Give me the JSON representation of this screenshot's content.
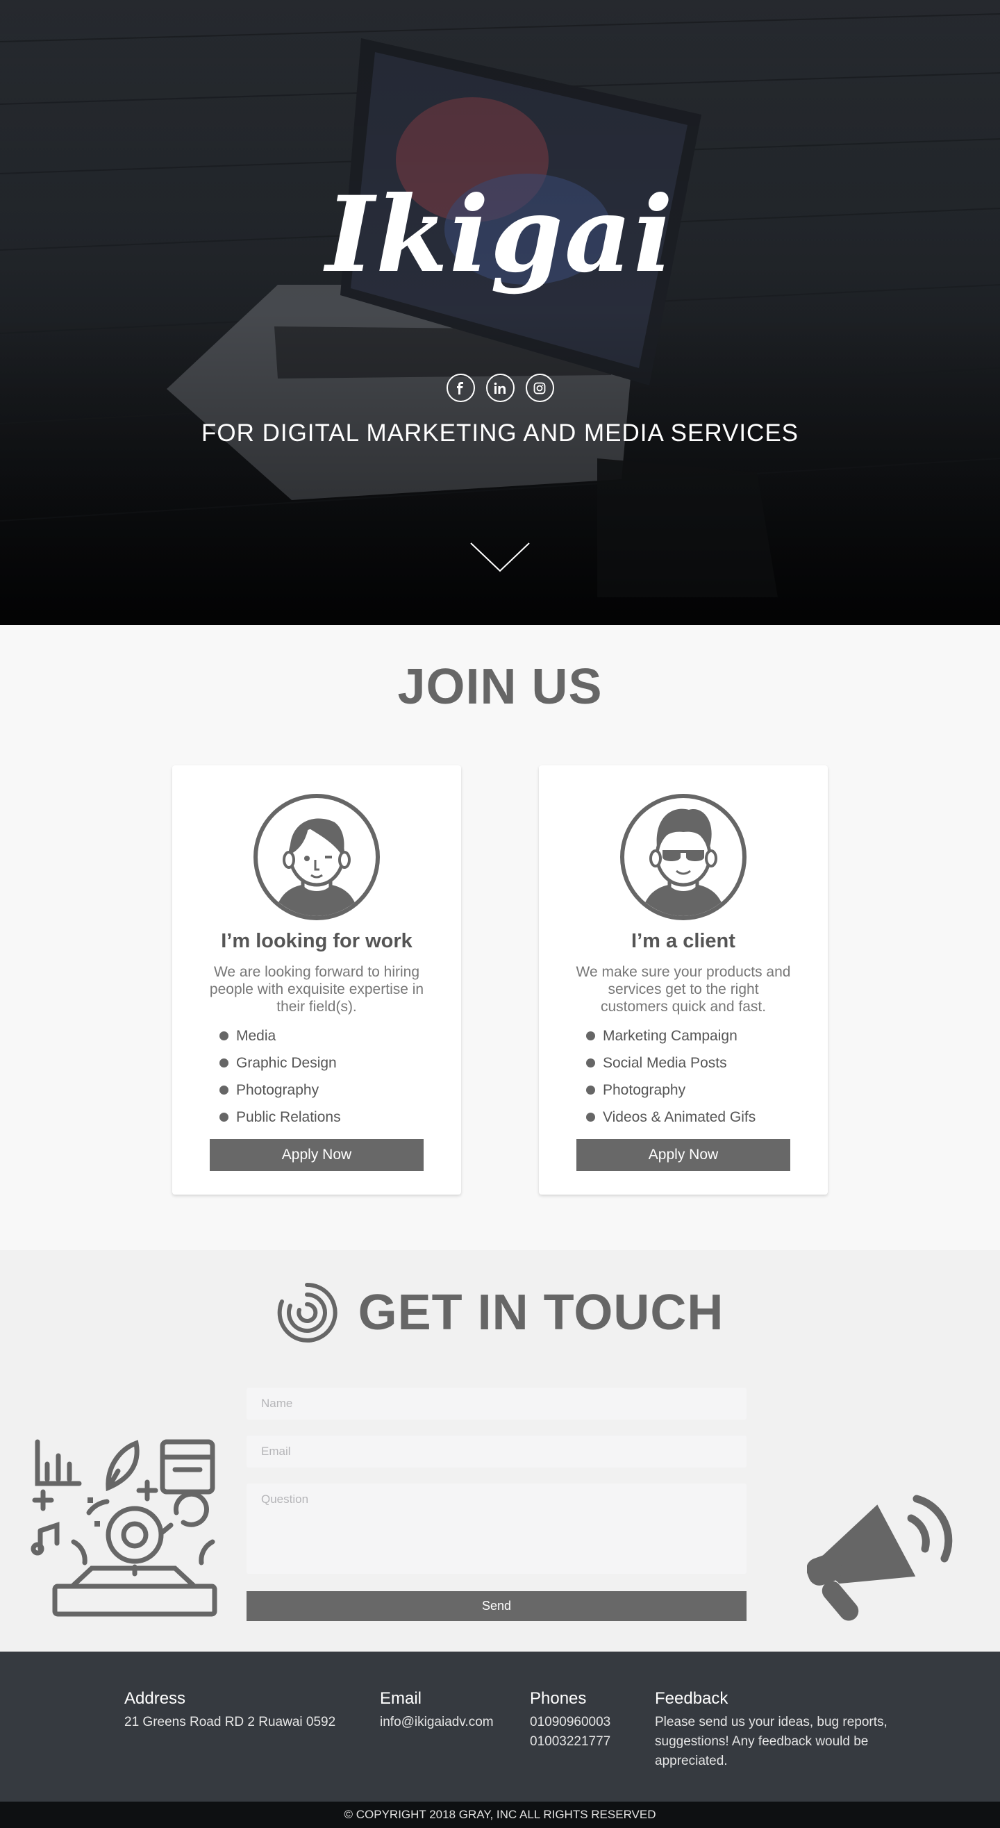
{
  "hero": {
    "logo": "Ikigai",
    "tagline": "FOR DIGITAL MARKETING AND MEDIA SERVICES",
    "socials": [
      {
        "name": "facebook",
        "glyph": "f"
      },
      {
        "name": "linkedin",
        "glyph": "in"
      },
      {
        "name": "instagram",
        "glyph": ""
      }
    ]
  },
  "join": {
    "title": "JOIN US",
    "cards": [
      {
        "title": "I’m looking for work",
        "description": "We are looking forward to hiring people with exquisite expertise in their field(s).",
        "items": [
          "Media",
          "Graphic Design",
          "Photography",
          "Public Relations"
        ],
        "button": "Apply Now"
      },
      {
        "title": "I’m a client",
        "description": "We make sure your products and services get to the right customers quick and fast.",
        "items": [
          "Marketing Campaign",
          "Social Media Posts",
          "Photography",
          "Videos & Animated Gifs"
        ],
        "button": "Apply Now"
      }
    ]
  },
  "contact": {
    "title": "GET IN TOUCH",
    "name_placeholder": "Name",
    "email_placeholder": "Email",
    "question_placeholder": "Question",
    "send_label": "Send"
  },
  "footer": {
    "address_title": "Address",
    "address": "21 Greens Road RD 2 Ruawai 0592",
    "email_title": "Email",
    "email": "info@ikigaiadv.com",
    "phones_title": "Phones",
    "phone1": "01090960003",
    "phone2": "01003221777",
    "feedback_title": "Feedback",
    "feedback": "Please send us your ideas, bug reports, suggestions! Any feedback would be appreciated.",
    "copyright": "© COPYRIGHT 2018 GRAY, INC ALL RIGHTS RESERVED"
  },
  "colors": {
    "primary_gray": "#666666",
    "button_gray": "#686868",
    "footer_bg": "#363a40",
    "copyright_bg": "#0e1012"
  }
}
